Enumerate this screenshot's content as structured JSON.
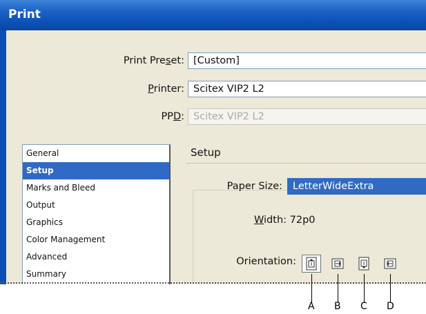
{
  "title": "Print",
  "preset": {
    "label_pre": "Print Pre",
    "label_key": "s",
    "label_post": "et:",
    "value": "[Custom]"
  },
  "printer": {
    "label_key": "P",
    "label_post": "rinter:",
    "value": "Scitex VIP2 L2"
  },
  "ppd": {
    "label_pre": "PP",
    "label_key": "D",
    "label_post": ":",
    "value": "Scitex VIP2 L2"
  },
  "categories": [
    "General",
    "Setup",
    "Marks and Bleed",
    "Output",
    "Graphics",
    "Color Management",
    "Advanced",
    "Summary"
  ],
  "selected_category": "Setup",
  "section_title": "Setup",
  "paper_size": {
    "label": "Paper Size:",
    "value": "LetterWideExtra"
  },
  "width": {
    "label_key": "W",
    "label_post": "idth:",
    "value": "72p0"
  },
  "orientation": {
    "label": "Orientation:",
    "buttons": [
      "portrait-icon",
      "landscape-icon",
      "reverse-portrait-icon",
      "reverse-landscape-icon"
    ]
  },
  "callouts": [
    "A",
    "B",
    "C",
    "D"
  ]
}
